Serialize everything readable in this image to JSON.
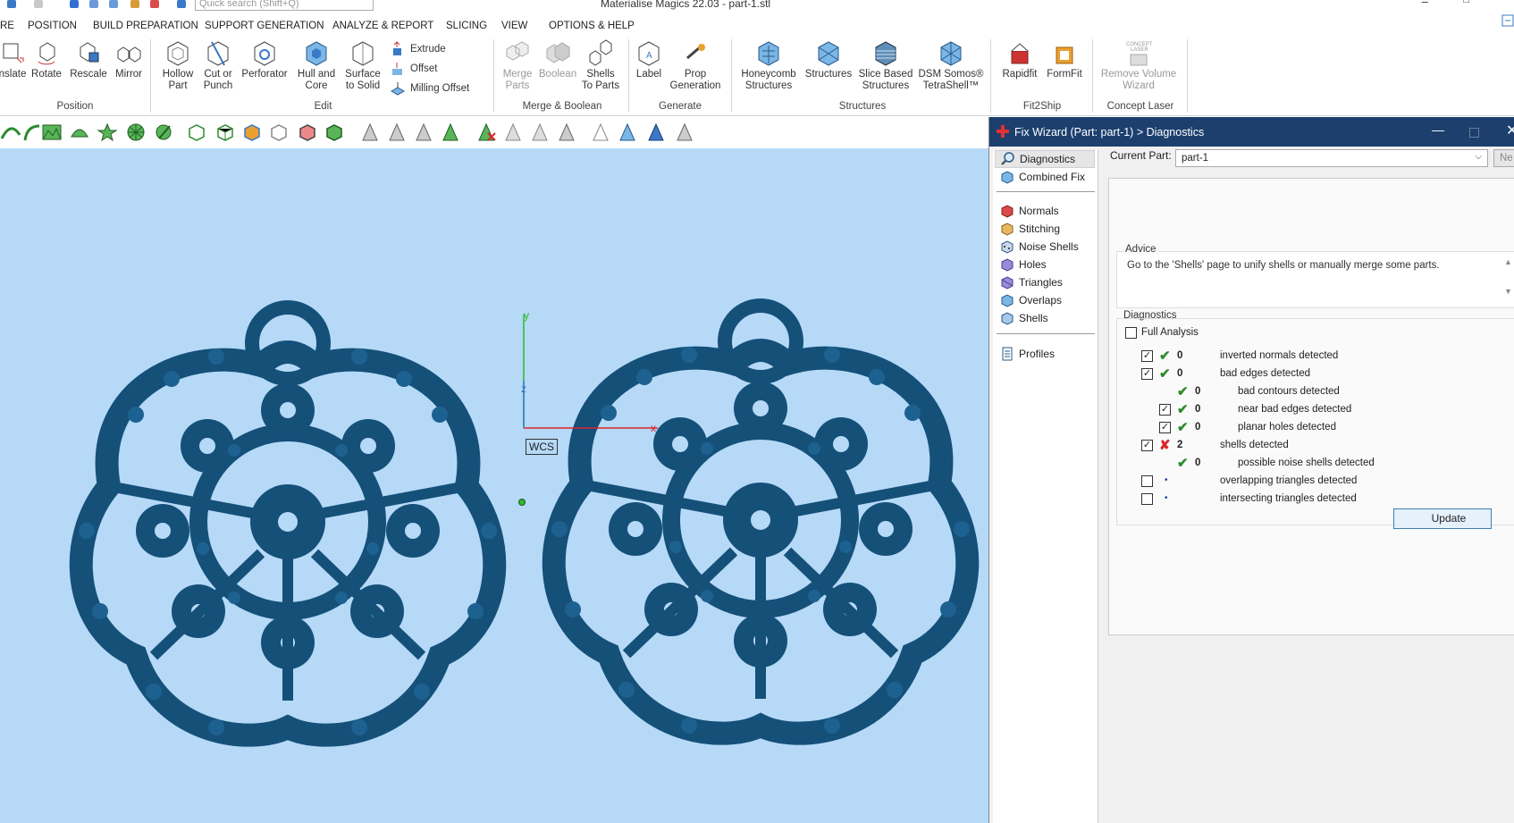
{
  "titlebar": {
    "app_title": "Materialise Magics 22.03 - part-1.stl",
    "search_placeholder": "Quick search (Shift+Q)",
    "minimize": "–",
    "maximize": "□"
  },
  "menu": [
    "RE",
    "POSITION",
    "BUILD PREPARATION",
    "SUPPORT GENERATION",
    "ANALYZE & REPORT",
    "SLICING",
    "VIEW",
    "OPTIONS & HELP"
  ],
  "ribbon": {
    "position": {
      "label": "Position",
      "buttons": [
        "nslate",
        "Rotate",
        "Rescale",
        "Mirror"
      ]
    },
    "edit": {
      "label": "Edit",
      "buttons": [
        "Hollow\nPart",
        "Cut or\nPunch",
        "Perforator",
        "Hull and\nCore",
        "Surface\nto Solid"
      ],
      "small": [
        "Extrude",
        "Offset",
        "Milling Offset"
      ]
    },
    "merge": {
      "label": "Merge & Boolean",
      "buttons": [
        "Merge\nParts",
        "Boolean",
        "Shells\nTo Parts"
      ]
    },
    "generate": {
      "label": "Generate",
      "buttons": [
        "Label",
        "Prop\nGeneration"
      ]
    },
    "structures": {
      "label": "Structures",
      "buttons": [
        "Honeycomb\nStructures",
        "Structures",
        "Slice Based\nStructures",
        "DSM Somos®\nTetraShell™"
      ]
    },
    "fit2ship": {
      "label": "Fit2Ship",
      "buttons": [
        "Rapidfit",
        "FormFit"
      ]
    },
    "concept": {
      "label": "Concept Laser",
      "buttons": [
        "Remove Volume\nWizard"
      ],
      "icon_text": "CONCEPT\nLASER"
    }
  },
  "viewport": {
    "wcs_label": "WCS",
    "axis_y": "y",
    "axis_z": "z",
    "axis_x": "x",
    "background": "#b5d9f7",
    "part_color": "#155079"
  },
  "fix_wizard": {
    "title": "Fix Wizard (Part: part-1) > Diagnostics",
    "close": "✕",
    "minimize": "—",
    "nav": {
      "top": [
        "Diagnostics",
        "Combined Fix"
      ],
      "tools": [
        "Normals",
        "Stitching",
        "Noise Shells",
        "Holes",
        "Triangles",
        "Overlaps",
        "Shells"
      ],
      "bottom": [
        "Profiles"
      ]
    },
    "current_part_label": "Current Part:",
    "current_part_value": "part-1",
    "next_button": "Ne",
    "advice_title": "Advice",
    "advice_text": "Go to the 'Shells' page to unify shells or manually merge some parts.",
    "diagnostics_title": "Diagnostics",
    "full_analysis_label": "Full Analysis",
    "full_analysis_checked": false,
    "rows": [
      {
        "checked": true,
        "status": "ok",
        "count": "0",
        "label": "inverted normals detected",
        "indent": 0
      },
      {
        "checked": true,
        "status": "ok",
        "count": "0",
        "label": "bad edges detected",
        "indent": 0
      },
      {
        "checked": null,
        "status": "ok",
        "count": "0",
        "label": "bad contours detected",
        "indent": 1
      },
      {
        "checked": true,
        "status": "ok",
        "count": "0",
        "label": "near bad edges detected",
        "indent": 1
      },
      {
        "checked": true,
        "status": "ok",
        "count": "0",
        "label": "planar holes detected",
        "indent": 1
      },
      {
        "checked": true,
        "status": "error",
        "count": "2",
        "label": "shells detected",
        "indent": 0
      },
      {
        "checked": null,
        "status": "ok",
        "count": "0",
        "label": "possible noise shells detected",
        "indent": 1
      },
      {
        "checked": false,
        "status": "none",
        "count": "",
        "label": "overlapping triangles detected",
        "indent": 0
      },
      {
        "checked": false,
        "status": "none",
        "count": "",
        "label": "intersecting triangles detected",
        "indent": 0
      }
    ],
    "update_button": "Update"
  }
}
